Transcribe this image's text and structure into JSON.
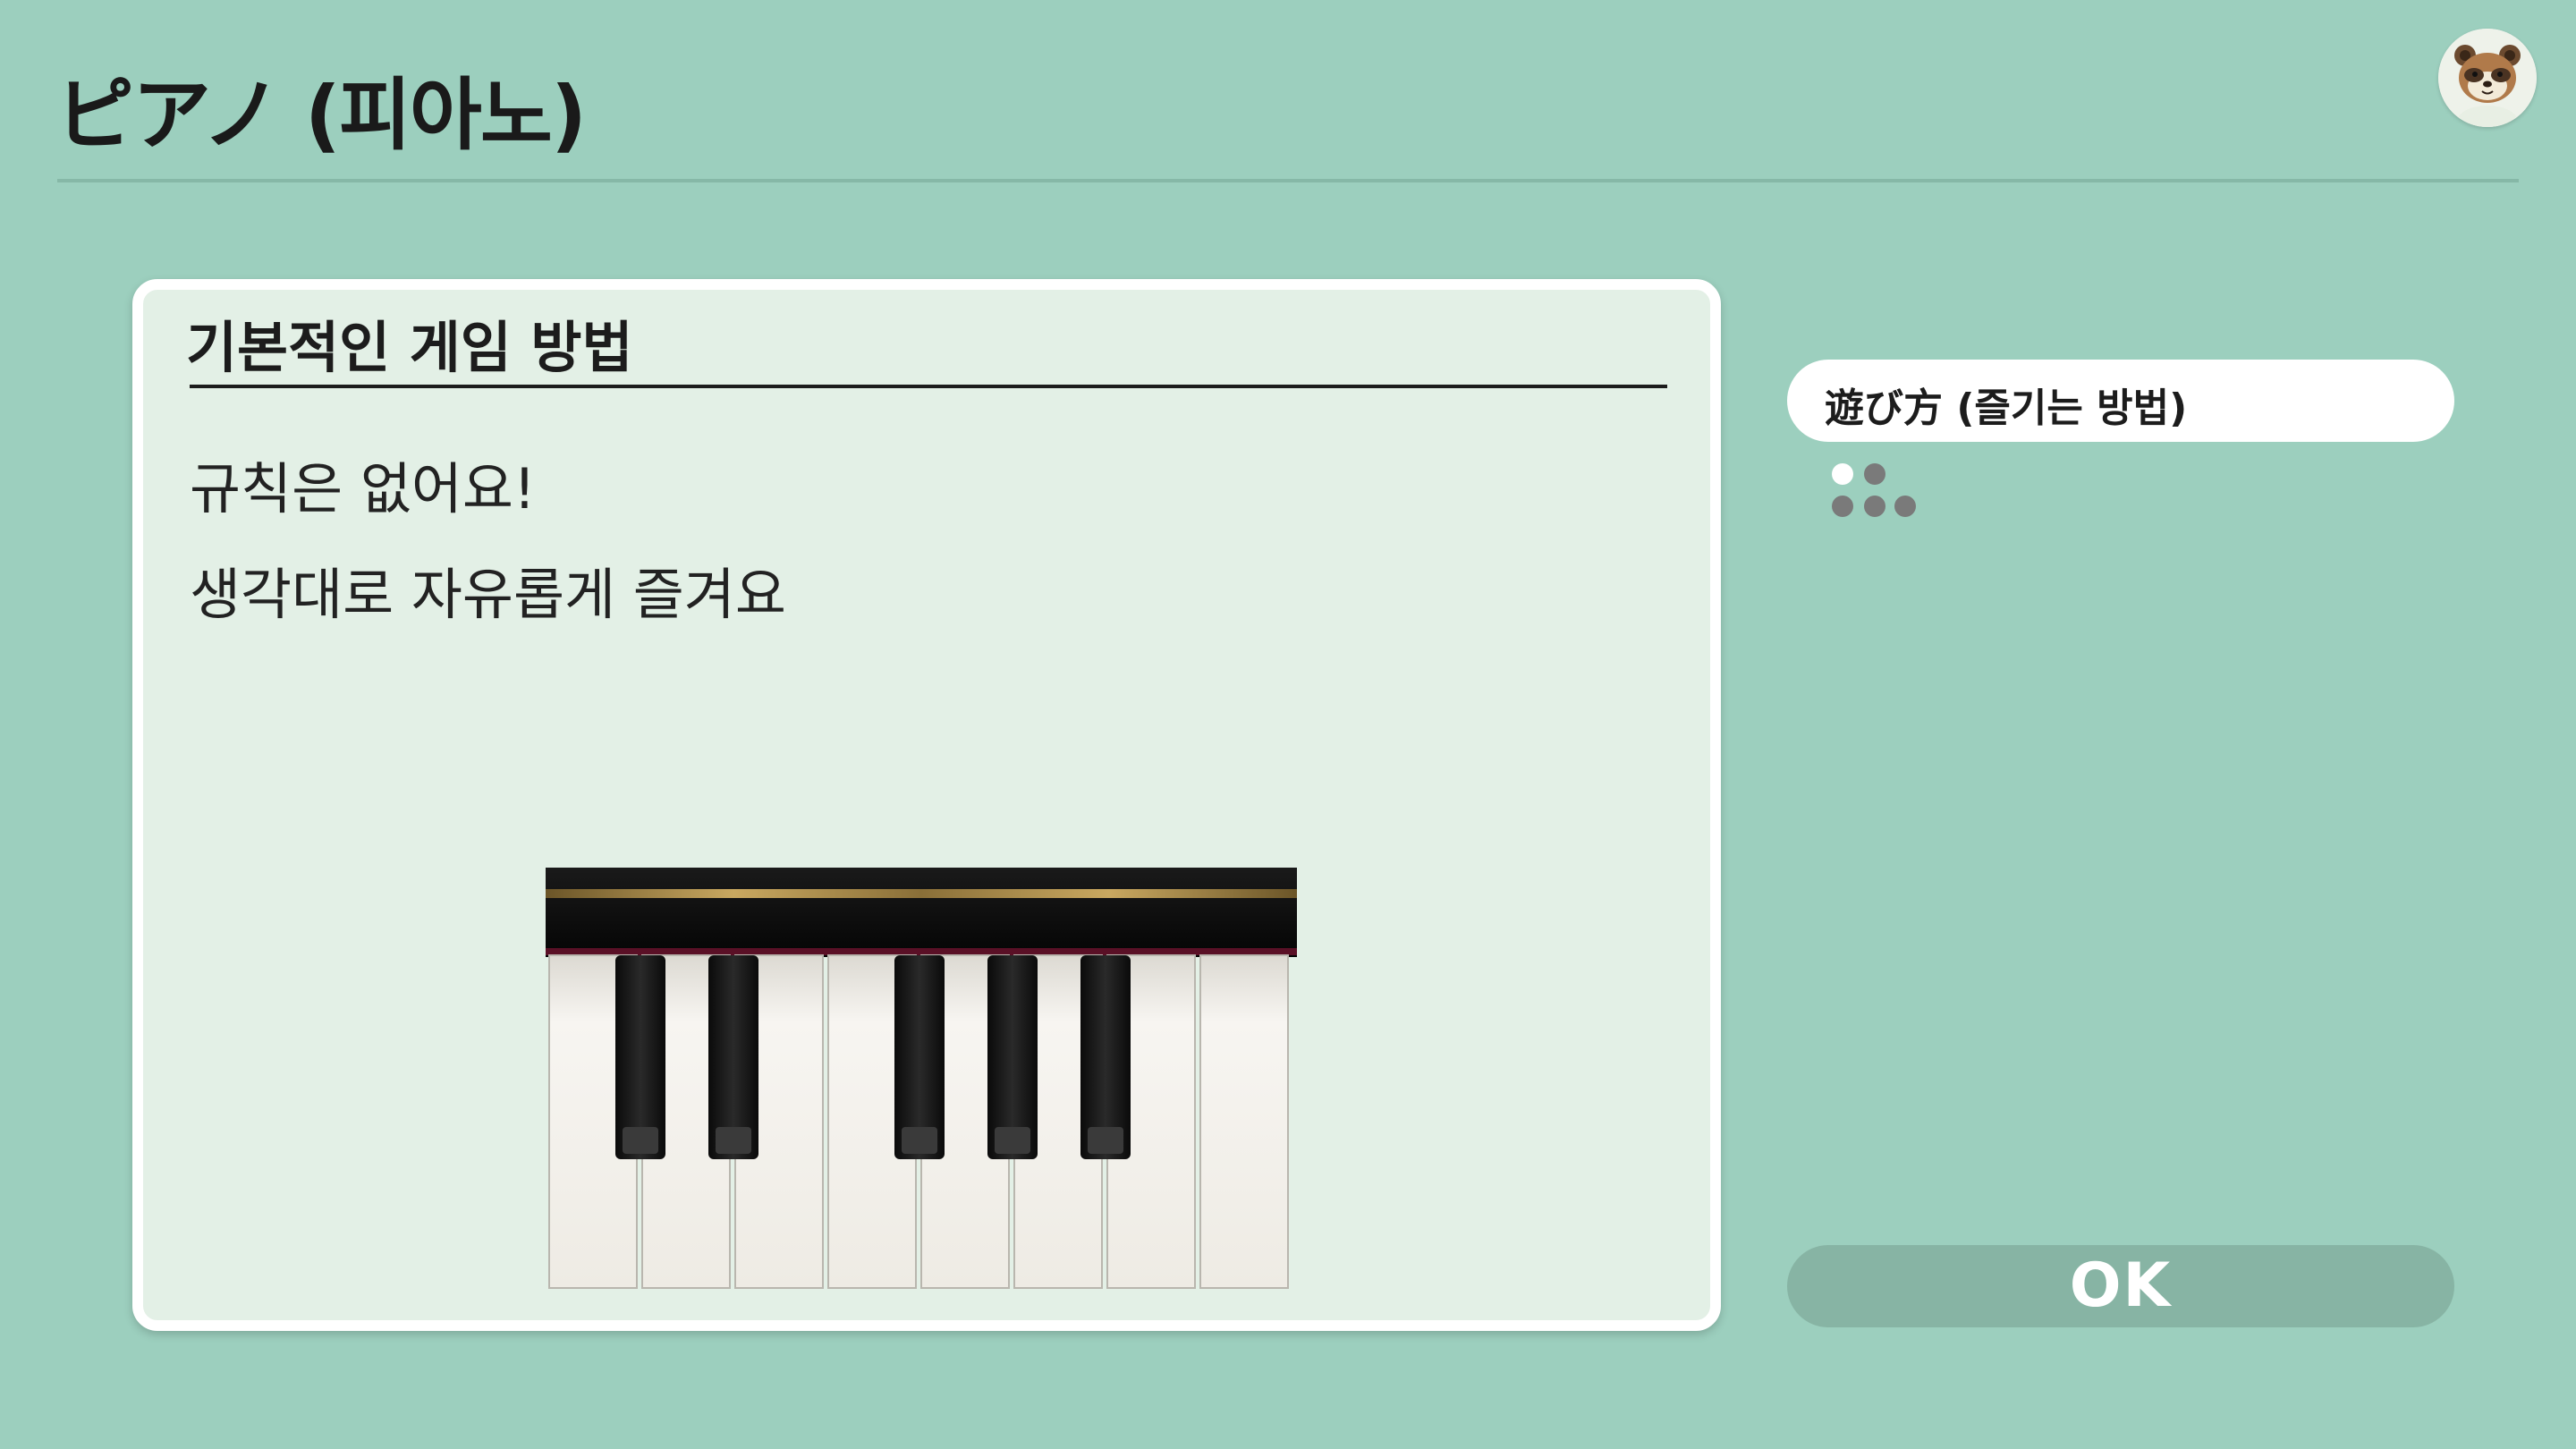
{
  "header": {
    "title": "ピアノ (피아노)"
  },
  "avatar": {
    "icon": "tom-nook-avatar-icon"
  },
  "card": {
    "heading": "기본적인 게임 방법",
    "lines": [
      "규칙은 없어요!",
      "생각대로 자유롭게 즐겨요"
    ],
    "image_icon": "piano-keyboard-icon"
  },
  "sidebar": {
    "tab_label": "遊び方 (즐기는 방법)",
    "page_indicator": {
      "total": 5,
      "current": 1
    }
  },
  "footer": {
    "ok_label": "OK"
  },
  "colors": {
    "background": "#9ccfbe",
    "card": "#e3f0e6",
    "ok_button": "#87b4a4"
  }
}
